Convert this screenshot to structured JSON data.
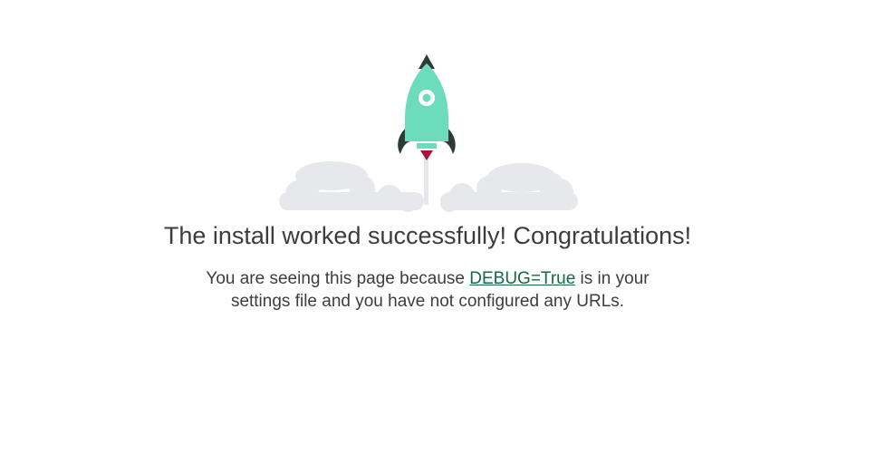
{
  "main": {
    "headline": "The install worked successfully! Congratulations!",
    "description_before": "You are seeing this page because ",
    "debug_link": "DEBUG=True",
    "description_line1_after": " is in your",
    "description_line2": "settings file and you have not configured any URLs."
  },
  "illustration": {
    "icon": "rocket-launch-icon",
    "colors": {
      "rocket_body": "#6ddcbd",
      "rocket_fins": "#2f3b37",
      "flame": "#a8123e",
      "smoke": "#e6e8ec"
    }
  },
  "colors": {
    "link": "#136a43",
    "text": "#3f3f3f",
    "background": "#ffffff"
  }
}
